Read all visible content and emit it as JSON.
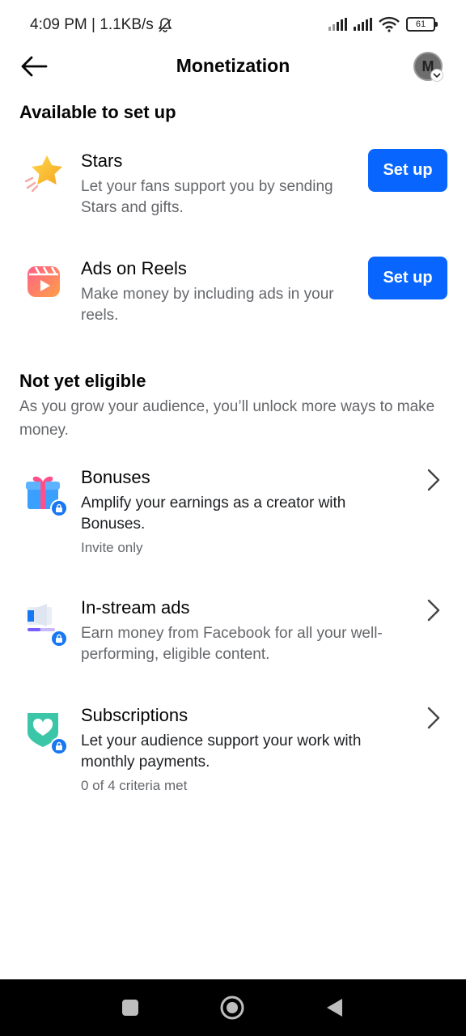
{
  "status_bar": {
    "time_speed": "4:09 PM | 1.1KB/s",
    "battery": "61"
  },
  "header": {
    "title": "Monetization",
    "avatar_initial": "M"
  },
  "available": {
    "heading": "Available to set up",
    "items": [
      {
        "title": "Stars",
        "description": "Let your fans support you by sending Stars and gifts.",
        "button": "Set up",
        "icon": "star-icon"
      },
      {
        "title": "Ads on Reels",
        "description": "Make money by including ads in your reels.",
        "button": "Set up",
        "icon": "reels-icon"
      }
    ]
  },
  "not_eligible": {
    "heading": "Not yet eligible",
    "description": "As you grow your audience, you’ll unlock more ways to make money.",
    "items": [
      {
        "title": "Bonuses",
        "description": "Amplify your earnings as a creator with Bonuses.",
        "meta": "Invite only",
        "icon": "gift-icon"
      },
      {
        "title": "In-stream ads",
        "description": "Earn money from Facebook for all your well-performing, eligible content.",
        "meta": "",
        "icon": "video-ad-icon"
      },
      {
        "title": "Subscriptions",
        "description": "Let your audience support your work with monthly payments.",
        "meta": "0 of 4 criteria met",
        "icon": "heart-shield-icon"
      }
    ]
  },
  "colors": {
    "primary_blue": "#0866ff",
    "lock_blue": "#1877f2",
    "secondary_text": "#65676b"
  }
}
